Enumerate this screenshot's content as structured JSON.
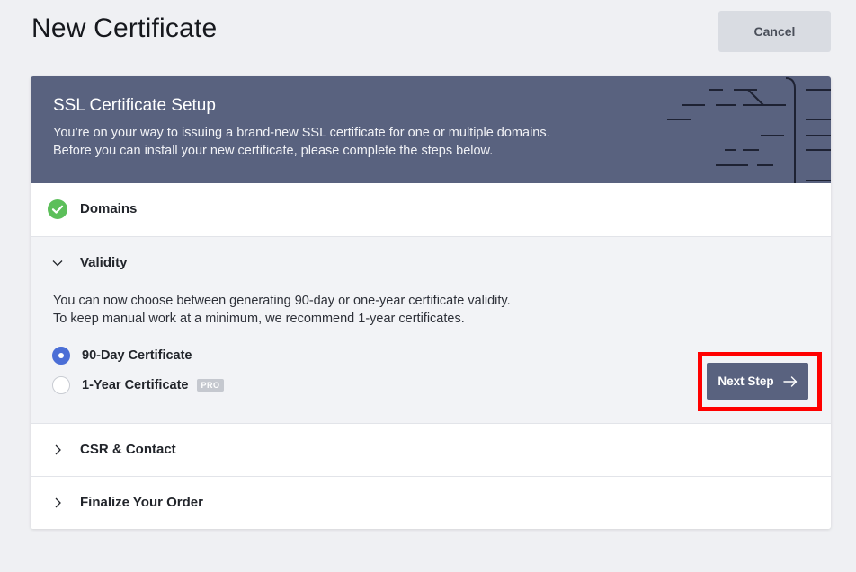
{
  "header": {
    "title": "New Certificate",
    "cancel_label": "Cancel"
  },
  "banner": {
    "title": "SSL Certificate Setup",
    "line1": "You’re on your way to issuing a brand-new SSL certificate for one or multiple domains.",
    "line2": "Before you can install your new certificate, please complete the steps below."
  },
  "steps": {
    "domains": {
      "label": "Domains",
      "status_icon": "check-circle-icon"
    },
    "validity": {
      "label": "Validity",
      "desc1": "You can now choose between generating 90-day or one-year certificate validity.",
      "desc2": "To keep manual work at a minimum, we recommend 1-year certificates.",
      "options": [
        {
          "label": "90-Day Certificate",
          "selected": true
        },
        {
          "label": "1-Year Certificate",
          "selected": false,
          "badge": "PRO"
        }
      ],
      "next_label": "Next Step"
    },
    "csr": {
      "label": "CSR & Contact"
    },
    "finalize": {
      "label": "Finalize Your Order"
    }
  },
  "colors": {
    "banner": "#59627f",
    "radio_selected": "#4b6ed6",
    "success": "#5cbf5a",
    "highlight": "#ff0000"
  }
}
